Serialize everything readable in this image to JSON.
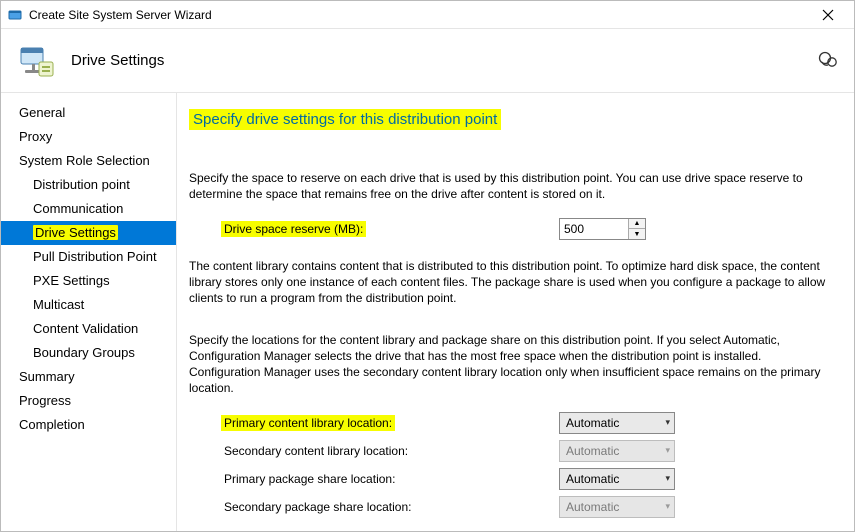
{
  "window": {
    "title": "Create Site System Server Wizard"
  },
  "header": {
    "title": "Drive Settings"
  },
  "sidebar": {
    "items": [
      {
        "label": "General",
        "sub": false
      },
      {
        "label": "Proxy",
        "sub": false
      },
      {
        "label": "System Role Selection",
        "sub": false
      },
      {
        "label": "Distribution point",
        "sub": true
      },
      {
        "label": "Communication",
        "sub": true
      },
      {
        "label": "Drive Settings",
        "sub": true,
        "selected": true,
        "highlighted": true
      },
      {
        "label": "Pull Distribution Point",
        "sub": true
      },
      {
        "label": "PXE Settings",
        "sub": true
      },
      {
        "label": "Multicast",
        "sub": true
      },
      {
        "label": "Content Validation",
        "sub": true
      },
      {
        "label": "Boundary Groups",
        "sub": true
      },
      {
        "label": "Summary",
        "sub": false
      },
      {
        "label": "Progress",
        "sub": false
      },
      {
        "label": "Completion",
        "sub": false
      }
    ]
  },
  "content": {
    "page_title": "Specify drive settings for this distribution point",
    "intro": "Specify the space to reserve on each drive that is used by this distribution point. You can use drive space reserve to determine the space that remains free on the drive after content is stored on it.",
    "drive_space_label": "Drive space reserve (MB):",
    "drive_space_value": "500",
    "library_info": "The content library contains content that is distributed to this distribution point. To optimize hard disk space, the content library stores only one instance of each content files. The package share is used when you configure a package to allow clients to run a program from the distribution point.",
    "location_info": "Specify the locations for the content library and package share on this distribution point. If you select Automatic, Configuration Manager selects the drive that has the most free space when the distribution point is installed. Configuration Manager uses the secondary content library location only when insufficient space remains on the primary location.",
    "locations": [
      {
        "label": "Primary content library location:",
        "value": "Automatic",
        "enabled": true,
        "highlighted": true
      },
      {
        "label": "Secondary content library location:",
        "value": "Automatic",
        "enabled": false,
        "highlighted": false
      },
      {
        "label": "Primary package share location:",
        "value": "Automatic",
        "enabled": true,
        "highlighted": false
      },
      {
        "label": "Secondary package share location:",
        "value": "Automatic",
        "enabled": false,
        "highlighted": false
      }
    ]
  }
}
